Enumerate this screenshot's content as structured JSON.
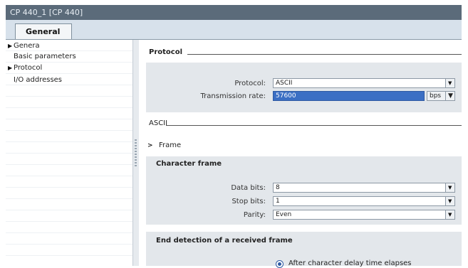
{
  "window": {
    "title": "CP 440_1 [CP 440]"
  },
  "tabs": [
    {
      "label": "General"
    }
  ],
  "nav": {
    "items": [
      {
        "label": "Genera",
        "expandable": true
      },
      {
        "label": "Basic parameters",
        "expandable": false
      },
      {
        "label": "Protocol",
        "expandable": true
      },
      {
        "label": "I/O addresses",
        "expandable": false
      }
    ]
  },
  "protocol_section": {
    "title": "Protocol",
    "protocol_label": "Protocol:",
    "protocol_value": "ASCII",
    "rate_label": "Transmission rate:",
    "rate_value": "57600",
    "rate_unit": "bps"
  },
  "ascii_section": {
    "title": "ASCII"
  },
  "frame_node": {
    "label": "Frame",
    "arrow": ">"
  },
  "character_frame": {
    "title": "Character frame",
    "data_bits_label": "Data bits:",
    "data_bits_value": "8",
    "stop_bits_label": "Stop bits:",
    "stop_bits_value": "1",
    "parity_label": "Parity:",
    "parity_value": "Even"
  },
  "end_detection": {
    "title": "End detection of a received frame",
    "option_label": "After character delay time elapses"
  },
  "colors": {
    "titlebar": "#5b6b7a",
    "selection": "#3b6fc4",
    "panel": "#e3e7eb"
  },
  "icons": {
    "dropdown": "chevron-down-icon",
    "tree_arrow": "triangle-right-icon"
  }
}
